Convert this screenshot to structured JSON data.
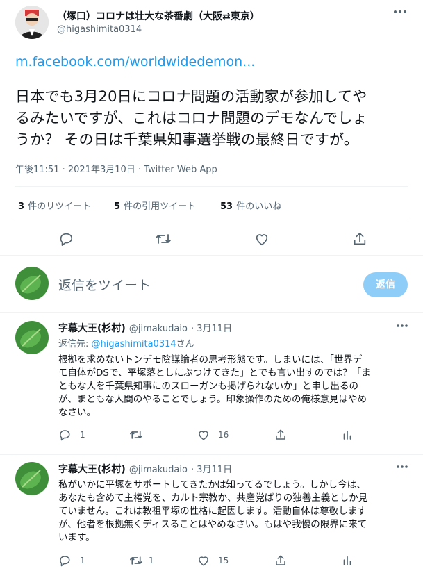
{
  "tweet": {
    "display_name": "（塚口）コロナは壮大な茶番劇（大阪⇄東京）",
    "handle": "@higashimita0314",
    "link": "m.facebook.com/worldwidedemon...",
    "text_lines": [
      "日本でも3月20日にコロナ問題の活動家が参加してや",
      "るみたいですが、これはコロナ問題のデモなんでしょ",
      "うか？ その日は千葉県知事選挙戦の最終日ですが。"
    ],
    "timestamp": "午後11:51 · 2021年3月10日 · Twitter Web App",
    "stats": {
      "retweets": "3",
      "retweets_label": "件のリツイート",
      "quotes": "5",
      "quotes_label": "件の引用ツイート",
      "likes": "53",
      "likes_label": "件のいいね"
    }
  },
  "compose": {
    "placeholder": "返信をツイート",
    "button": "返信"
  },
  "replies": [
    {
      "display_name": "字幕大王(杉村)",
      "handle": "@jimakudaio",
      "date": "· 3月11日",
      "replying_to_prefix": "返信先: ",
      "replying_to_user": "@higashimita0314",
      "replying_to_suffix": "さん",
      "lines": [
        "根拠を求めないトンデモ陰謀論者の思考形態です。しまいには、「世界デ",
        "モ自体がDSで、平塚落としにぶつけてきた」とでも言い出すのでは？「ま",
        "ともな人を千葉県知事にのスローガンも掲げられないか」と申し出るの",
        "が、まともな人間のやることでしょう。印象操作のための俺様意見はやめ",
        "なさい。"
      ],
      "counts": {
        "replies": "1",
        "retweets": "",
        "likes": "16"
      }
    },
    {
      "display_name": "字幕大王(杉村)",
      "handle": "@jimakudaio",
      "date": "· 3月11日",
      "lines": [
        "私がいかに平塚をサポートしてきたかは知ってるでしょう。しかし今は、",
        "あなたも含めて主権党を、カルト宗教か、共産党ばりの独善主義としか見",
        "ていません。これは教祖平塚の性格に起因します。活動自体は尊敬します",
        "が、他者を根拠無くディスることはやめなさい。もはや我慢の限界に来て",
        "います。"
      ],
      "counts": {
        "replies": "1",
        "retweets": "1",
        "likes": "15"
      }
    }
  ],
  "colors": {
    "accent": "#1d9bf0",
    "muted": "#536471",
    "reply_button": "#8ecdf8"
  },
  "icons": [
    "more-icon",
    "reply-icon",
    "retweet-icon",
    "like-icon",
    "share-icon",
    "analytics-icon"
  ]
}
